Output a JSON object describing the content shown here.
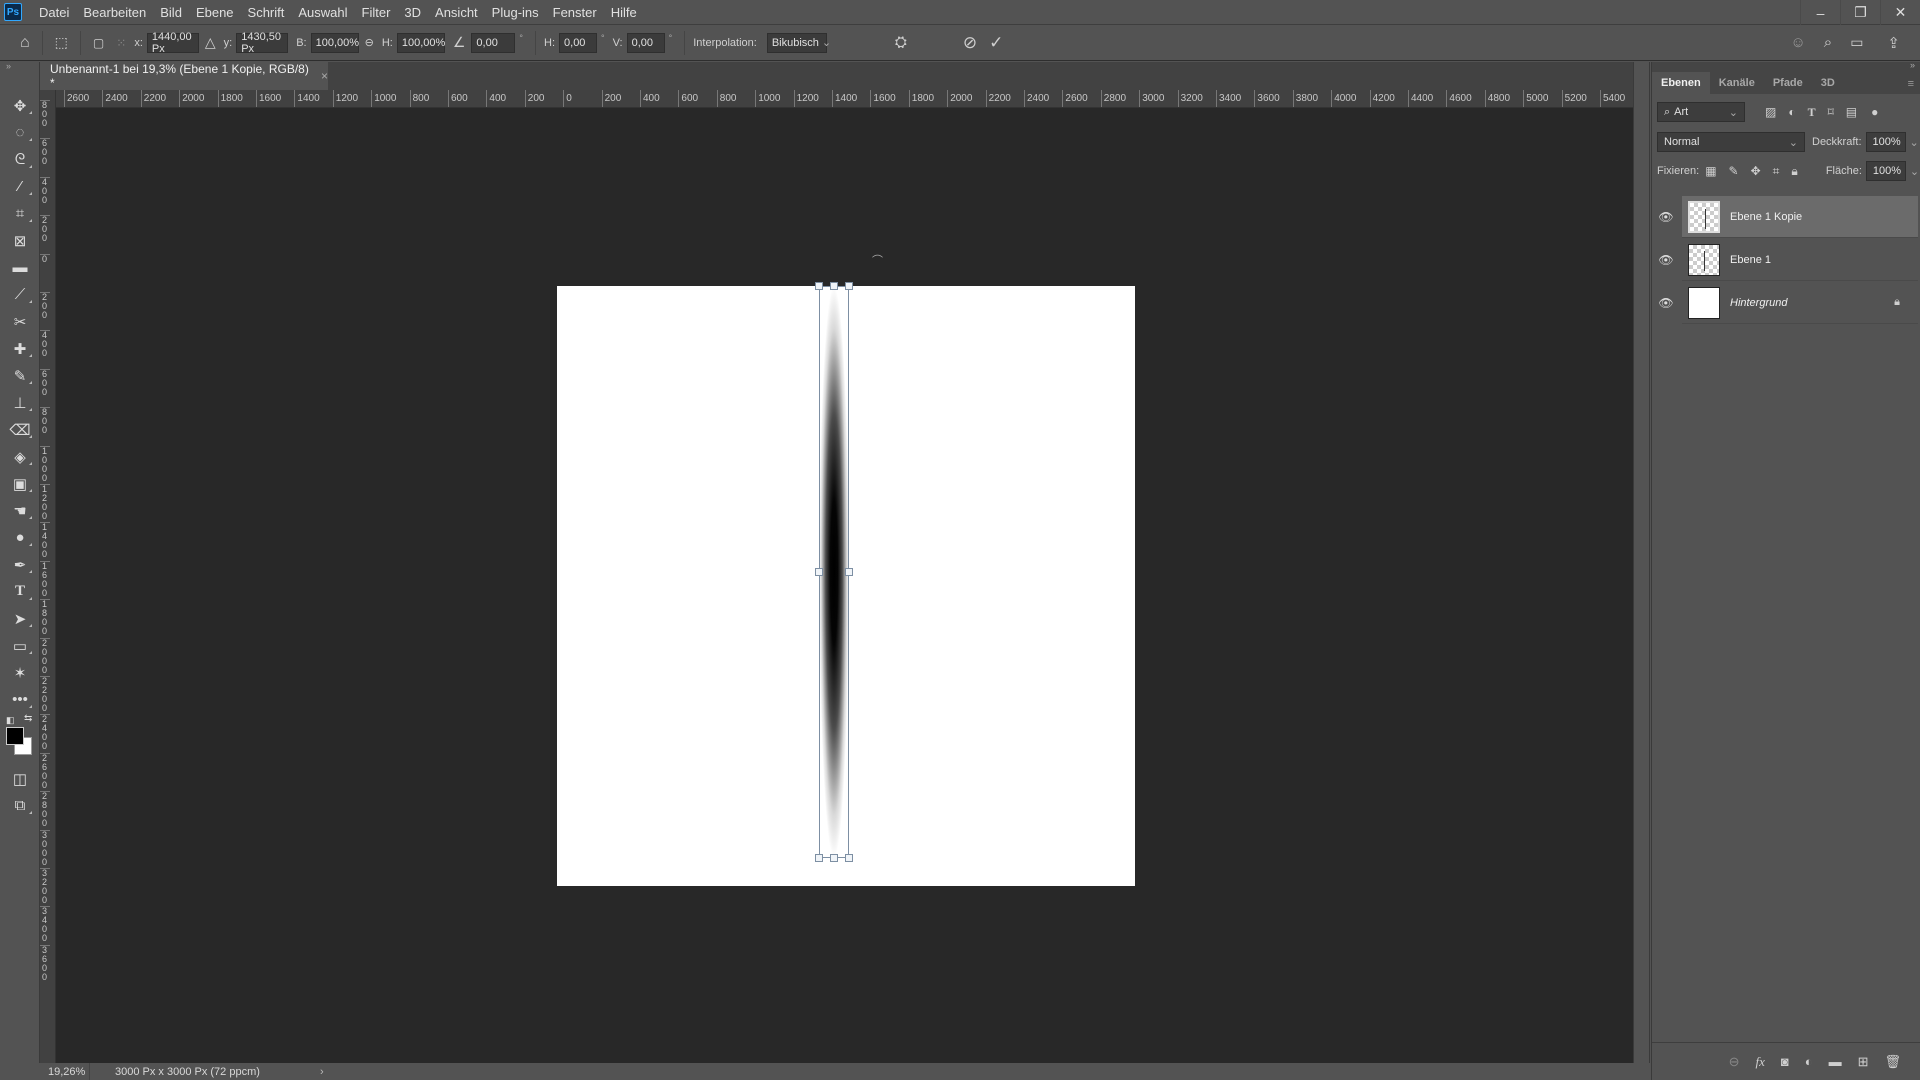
{
  "app": {
    "logo": "Ps"
  },
  "menu": [
    "Datei",
    "Bearbeiten",
    "Bild",
    "Ebene",
    "Schrift",
    "Auswahl",
    "Filter",
    "3D",
    "Ansicht",
    "Plug-ins",
    "Fenster",
    "Hilfe"
  ],
  "window_controls": {
    "minimize": "–",
    "restore": "❐",
    "close": "✕"
  },
  "options": {
    "x_label": "x:",
    "x_value": "1440,00 Px",
    "y_label": "y:",
    "y_value": "1430,50 Px",
    "w_label": "B:",
    "w_value": "100,00%",
    "h_label": "H:",
    "h_value": "100,00%",
    "angle_value": "0,00",
    "hskew_label": "H:",
    "hskew_value": "0,00",
    "vskew_label": "V:",
    "vskew_value": "0,00",
    "degree": "°",
    "interp_label": "Interpolation:",
    "interp_value": "Bikubisch"
  },
  "document_tab": {
    "title": "Unbenannt-1 bei 19,3% (Ebene 1 Kopie, RGB/8) *",
    "close": "×"
  },
  "ruler_h": [
    "2600",
    "2400",
    "2200",
    "2000",
    "1800",
    "1600",
    "1400",
    "1200",
    "1000",
    "800",
    "600",
    "400",
    "200",
    "0",
    "200",
    "400",
    "600",
    "800",
    "1000",
    "1200",
    "1400",
    "1600",
    "1800",
    "2000",
    "2200",
    "2400",
    "2600",
    "2800",
    "3000",
    "3200",
    "3400",
    "3600",
    "3800",
    "4000",
    "4200",
    "4400",
    "4600",
    "4800",
    "5000",
    "5200",
    "5400"
  ],
  "ruler_v": [
    "8",
    "6",
    "4",
    "2",
    "0",
    "2",
    "4",
    "6",
    "8",
    "10",
    "12",
    "14",
    "16",
    "18",
    "20",
    "22",
    "24",
    "26",
    "28",
    "30",
    "32",
    "34",
    "36"
  ],
  "status": {
    "zoom": "19,26%",
    "doc_info": "3000 Px x 3000 Px (72 ppcm)",
    "arrow": "›"
  },
  "panel": {
    "tabs": [
      "Ebenen",
      "Kanäle",
      "Pfade",
      "3D"
    ],
    "filter_label": "Art",
    "blend_mode": "Normal",
    "opacity_label": "Deckkraft:",
    "opacity_value": "100%",
    "lock_label": "Fixieren:",
    "fill_label": "Fläche:",
    "fill_value": "100%",
    "layers": [
      {
        "name": "Ebene 1 Kopie",
        "selected": true
      },
      {
        "name": "Ebene 1",
        "selected": false
      },
      {
        "name": "Hintergrund",
        "selected": false,
        "locked": true
      }
    ]
  }
}
